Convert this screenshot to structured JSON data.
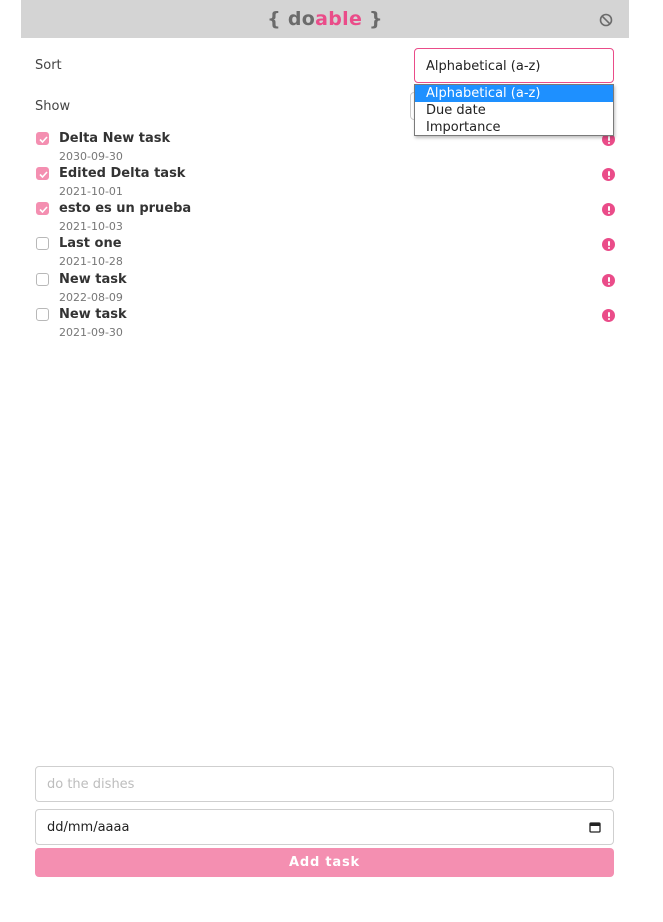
{
  "header": {
    "logo_open": "{ ",
    "logo_do": "do",
    "logo_able": "able",
    "logo_close": " }",
    "logout_icon": "block-icon"
  },
  "sort": {
    "label": "Sort",
    "selected": "Alphabetical (a-z)",
    "options": [
      "Alphabetical (a-z)",
      "Due date",
      "Importance"
    ]
  },
  "show": {
    "label": "Show"
  },
  "tasks": [
    {
      "title": "Delta New task",
      "date": "2030-09-30",
      "done": true
    },
    {
      "title": "Edited Delta task",
      "date": "2021-10-01",
      "done": true
    },
    {
      "title": "esto es un prueba",
      "date": "2021-10-03",
      "done": true
    },
    {
      "title": "Last one",
      "date": "2021-10-28",
      "done": false
    },
    {
      "title": "New task",
      "date": "2022-08-09",
      "done": false
    },
    {
      "title": "New task",
      "date": "2021-09-30",
      "done": false
    }
  ],
  "form": {
    "title_placeholder": "do the dishes",
    "date_value": "dd/mm/aaaa",
    "add_label": "Add task"
  },
  "colors": {
    "accent": "#ea4c89",
    "button": "#f48fb1",
    "header_bg": "#d4d4d4"
  }
}
